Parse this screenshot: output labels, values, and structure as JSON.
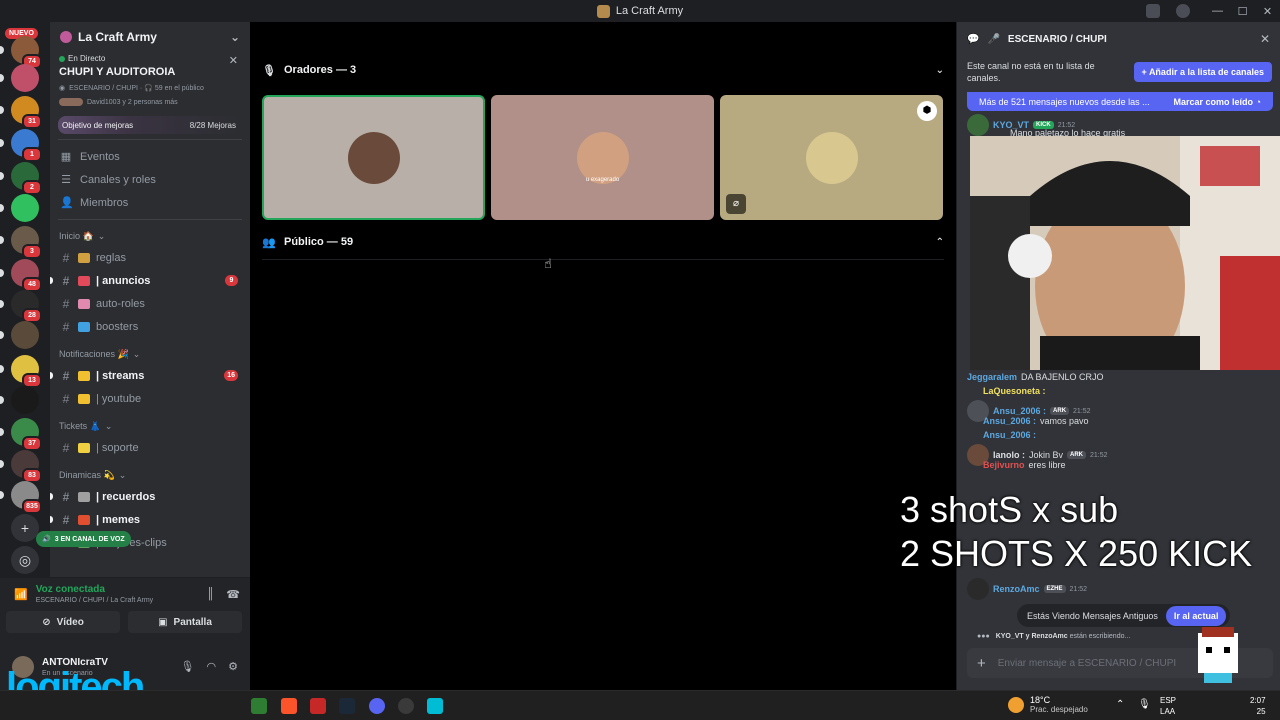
{
  "window": {
    "title": "La Craft Army",
    "controls": [
      "—",
      "☐",
      "✕"
    ]
  },
  "rail": {
    "nuevo_label": "NUEVO",
    "servers": [
      {
        "badge": "74",
        "color": "#8a5a3a"
      },
      {
        "badge": "",
        "color": "#c0506a"
      },
      {
        "badge": "31",
        "color": "#d08a20"
      },
      {
        "badge": "1",
        "color": "#3a7ad0"
      },
      {
        "badge": "2",
        "color": "#2a6a3a"
      },
      {
        "badge": "",
        "color": "#30c060"
      },
      {
        "badge": "3",
        "color": "#6a5a4a"
      },
      {
        "badge": "48",
        "color": "#a04a5a"
      },
      {
        "badge": "28",
        "color": "#2a2a2a"
      },
      {
        "badge": "",
        "color": "#5a4a3a"
      },
      {
        "badge": "13",
        "color": "#e0c040"
      },
      {
        "badge": "",
        "color": "#1a1a1a"
      },
      {
        "badge": "37",
        "color": "#3a8a4a"
      },
      {
        "badge": "83",
        "color": "#4a3a3a"
      },
      {
        "badge": "835",
        "color": "#8a8a8a"
      }
    ],
    "add_server_icon": "plus-icon",
    "discover_icon": "compass-icon"
  },
  "sidebar": {
    "server_name": "La Craft Army",
    "live": {
      "status": "En Directo",
      "title": "CHUPI Y AUDITOROIA",
      "meta": "ESCENARIO / CHUPI · 🎧 59 en el público",
      "listeners": "David1003 y 2 personas más"
    },
    "boost": {
      "label": "Objetivo de mejoras",
      "progress": "8/28 Mejoras"
    },
    "nav": [
      {
        "icon": "calendar-icon",
        "label": "Eventos"
      },
      {
        "icon": "browse-channels-icon",
        "label": "Canales y roles"
      },
      {
        "icon": "members-icon",
        "label": "Miembros"
      }
    ],
    "categories": [
      {
        "name": "Inicio 🏠",
        "channels": [
          {
            "label": "reglas",
            "unread": false,
            "badge": "",
            "emoji_color": "#d0a040"
          },
          {
            "label": "| anuncios",
            "unread": true,
            "badge": "9",
            "emoji_color": "#e04a5a"
          },
          {
            "label": "auto-roles",
            "unread": false,
            "badge": "",
            "emoji_color": "#e08ab0"
          },
          {
            "label": "boosters",
            "unread": false,
            "badge": "",
            "emoji_color": "#40a0e0"
          }
        ]
      },
      {
        "name": "Notificaciones 🎉",
        "channels": [
          {
            "label": "| streams",
            "unread": true,
            "badge": "16",
            "emoji_color": "#f0c030"
          },
          {
            "label": "| youtube",
            "unread": false,
            "badge": "",
            "emoji_color": "#f0c030"
          }
        ]
      },
      {
        "name": "Tickets 👗",
        "channels": [
          {
            "label": "| soporte",
            "unread": false,
            "badge": "",
            "emoji_color": "#f0d040"
          }
        ]
      },
      {
        "name": "Dinamicas 💫",
        "channels": [
          {
            "label": "| recuerdos",
            "unread": true,
            "badge": "",
            "emoji_color": "#a0a0a0"
          },
          {
            "label": "| memes",
            "unread": true,
            "badge": "",
            "emoji_color": "#e05030"
          },
          {
            "label": "| mejores-clips",
            "unread": false,
            "badge": "",
            "emoji_color": "#60a060"
          }
        ]
      }
    ],
    "voice_pill": "3 EN CANAL DE VOZ"
  },
  "voice": {
    "title": "Voz conectada",
    "sub": "ESCENARIO / CHUPI / La Craft Army",
    "video_label": "Vídeo",
    "screen_label": "Pantalla"
  },
  "user": {
    "name": "ANTONIcraTV",
    "status": "En un escenario"
  },
  "stage": {
    "speakers_label": "Oradores — 3",
    "audience_label": "Público — 59",
    "tiles": [
      {
        "bg": "#b8b0a8",
        "avatar": "#6a4a3a",
        "label": ""
      },
      {
        "bg": "#b09088",
        "avatar": "#d0a080",
        "label": "u exagerado"
      },
      {
        "bg": "#b8aa80",
        "avatar": "#d8c890",
        "label": ""
      }
    ]
  },
  "chat": {
    "header": "ESCENARIO / CHUPI",
    "notice": "Este canal no está en tu lista de canales.",
    "add_button": "Añadir a la lista de canales",
    "new_messages": "Más de 521 mensajes nuevos desde las ...",
    "mark_read": "Marcar como leído",
    "messages": [
      {
        "user": "KYO_VT",
        "tag": "KICK",
        "time": "21:52",
        "text": "Mano paletazo lo hace gratis"
      },
      {
        "user": "Jeggaralem",
        "tag": "",
        "time": "",
        "text": "DA BAJENLO CRJO"
      },
      {
        "user": "LaQuesoneta :",
        "tag": "",
        "time": "",
        "text": ""
      },
      {
        "user": "Ansu_2006 :",
        "tag": "ARK",
        "time": "21:52",
        "text": ""
      },
      {
        "user": "Ansu_2006 :",
        "tag": "",
        "time": "",
        "text": "vamos pavo"
      },
      {
        "user": "Ansu_2006 :",
        "tag": "",
        "time": "",
        "text": ""
      },
      {
        "user": "Ianolo :",
        "tag": "ARK",
        "time": "21:52",
        "text": "Jokin Bv"
      },
      {
        "user": "Bejivurno",
        "tag": "",
        "time": "",
        "text": "eres libre"
      },
      {
        "user": "RenzoAmc",
        "tag": "EZHE",
        "time": "21:52",
        "text": ""
      }
    ],
    "overlay_lines": [
      "3 shotS x sub",
      "2 SHOTS X 250 KICK"
    ],
    "old_messages": "Estás Viendo Mensajes Antiguos",
    "jump_button": "Ir al actual",
    "typing": {
      "names": "KYO_VT y RenzoAmc",
      "suffix": "están escribiendo..."
    },
    "composer_placeholder": "Enviar mensaje a ESCENARIO / CHUPI"
  },
  "taskbar": {
    "weather_temp": "18°C",
    "weather_desc": "Prac. despejado",
    "lang_top": "ESP",
    "lang_bottom": "LAA",
    "clock_top": "2:07",
    "clock_bottom": "25"
  },
  "brand_watermark": "logitech"
}
